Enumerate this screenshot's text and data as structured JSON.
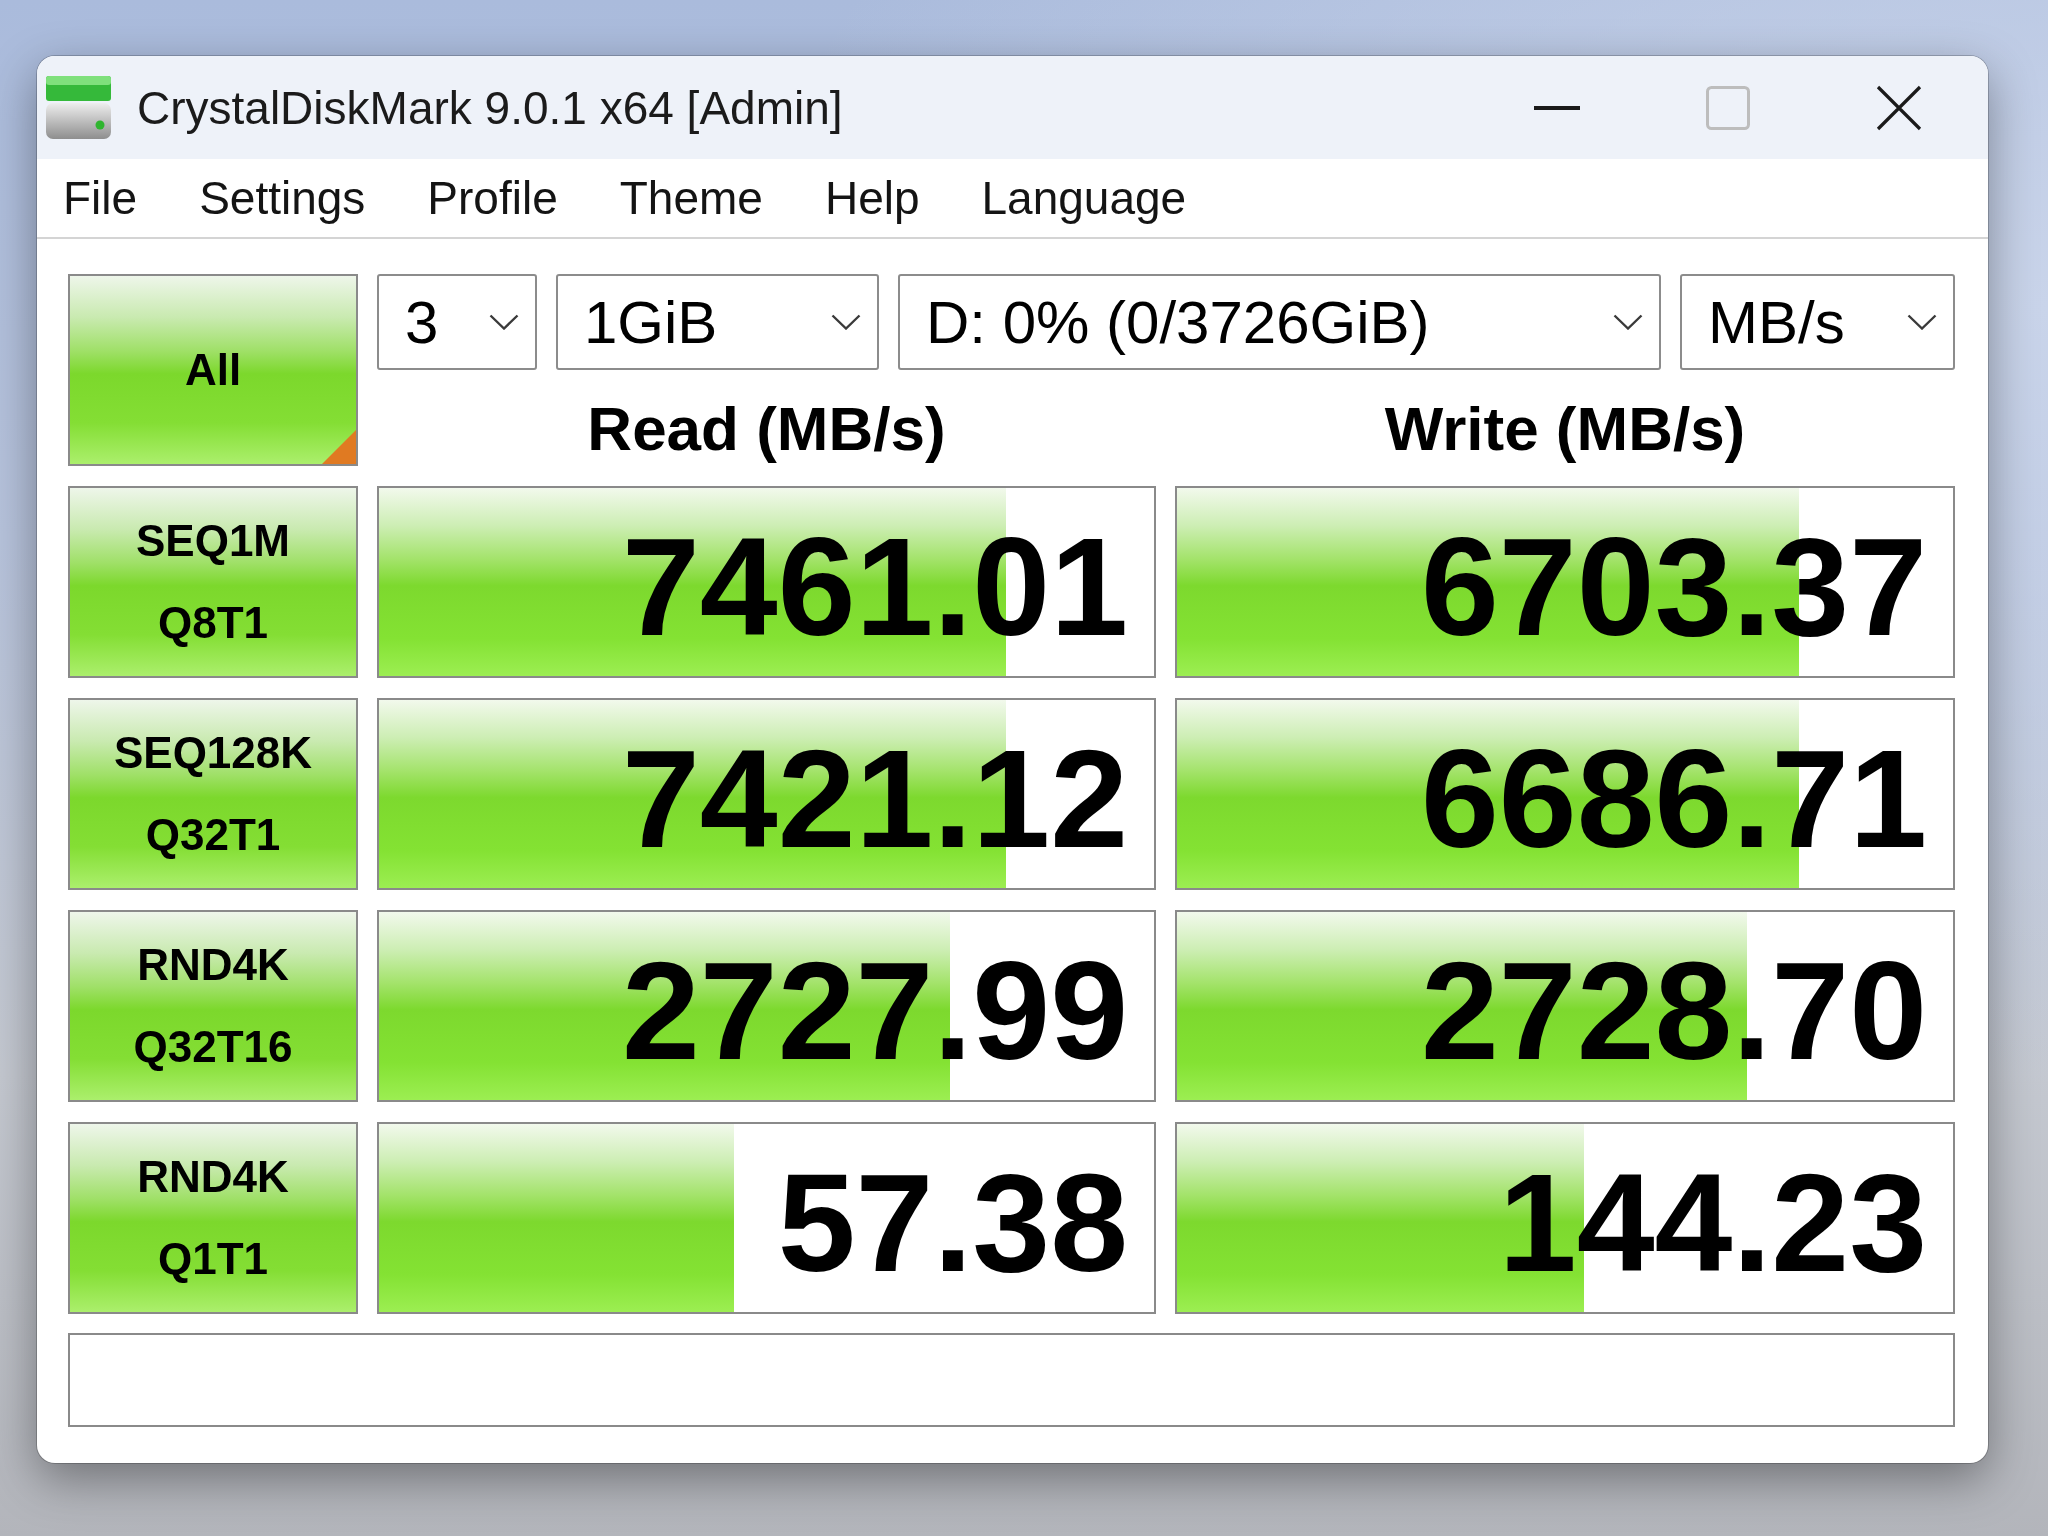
{
  "window": {
    "title": "CrystalDiskMark 9.0.1 x64 [Admin]",
    "maximize_disabled": true
  },
  "menu": [
    "File",
    "Settings",
    "Profile",
    "Theme",
    "Help",
    "Language"
  ],
  "toolbar": {
    "all_button": "All",
    "dropdowns": [
      {
        "value": "3"
      },
      {
        "value": "1GiB"
      },
      {
        "value": "D: 0% (0/3726GiB)"
      },
      {
        "value": "MB/s"
      }
    ]
  },
  "column_headers": [
    "Read (MB/s)",
    "Write (MB/s)"
  ],
  "tests": [
    {
      "name": "SEQ1M",
      "queue_threads": "Q8T1",
      "results": [
        {
          "value": "7461.01",
          "level": 0.809
        },
        {
          "value": "6703.37",
          "level": 0.801
        }
      ]
    },
    {
      "name": "SEQ128K",
      "queue_threads": "Q32T1",
      "results": [
        {
          "value": "7421.12",
          "level": 0.809
        },
        {
          "value": "6686.71",
          "level": 0.801
        }
      ]
    },
    {
      "name": "RND4K",
      "queue_threads": "Q32T16",
      "results": [
        {
          "value": "2727.99",
          "level": 0.737
        },
        {
          "value": "2728.70",
          "level": 0.734
        }
      ]
    },
    {
      "name": "RND4K",
      "queue_threads": "Q1T1",
      "results": [
        {
          "value": "57.38",
          "level": 0.458
        },
        {
          "value": "144.23",
          "level": 0.524
        }
      ]
    }
  ]
}
